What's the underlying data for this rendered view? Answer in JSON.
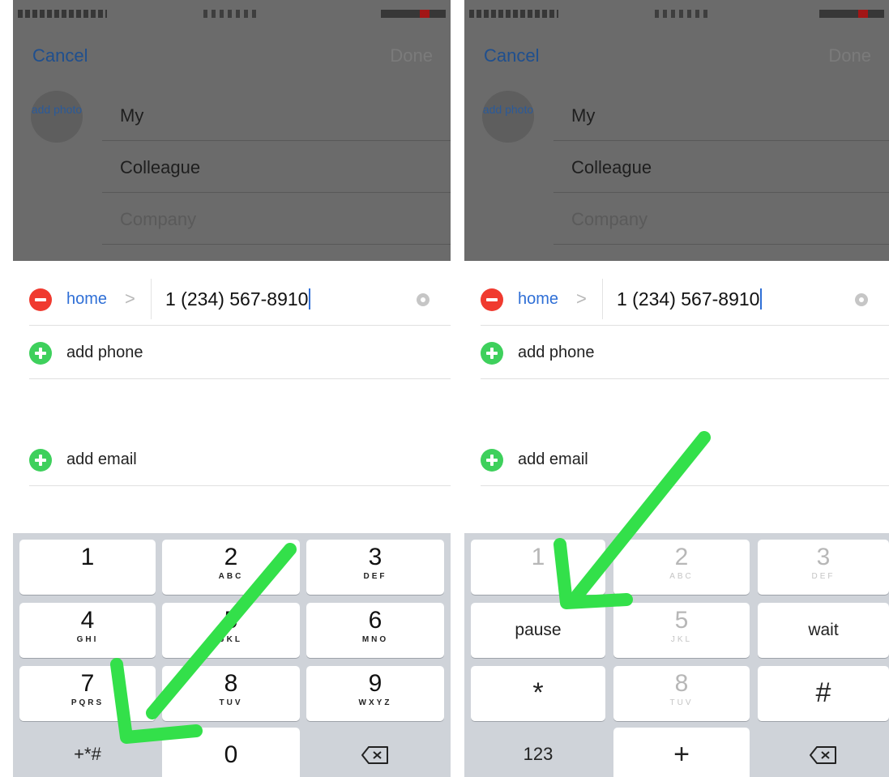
{
  "left": {
    "nav": {
      "cancel": "Cancel",
      "done": "Done"
    },
    "add_photo": "add photo",
    "first_name": "My",
    "last_name": "Colleague",
    "company_placeholder": "Company",
    "phone": {
      "label": "home",
      "chevron": ">",
      "value": "1 (234) 567-8910"
    },
    "add_phone": "add phone",
    "add_email": "add email",
    "keypad": {
      "keys": [
        {
          "digit": "1",
          "letters": ""
        },
        {
          "digit": "2",
          "letters": "ABC"
        },
        {
          "digit": "3",
          "letters": "DEF"
        },
        {
          "digit": "4",
          "letters": "GHI"
        },
        {
          "digit": "5",
          "letters": "JKL"
        },
        {
          "digit": "6",
          "letters": "MNO"
        },
        {
          "digit": "7",
          "letters": "PQRS"
        },
        {
          "digit": "8",
          "letters": "TUV"
        },
        {
          "digit": "9",
          "letters": "WXYZ"
        }
      ],
      "symbols_key": "+*#",
      "zero": "0"
    }
  },
  "right": {
    "nav": {
      "cancel": "Cancel",
      "done": "Done"
    },
    "add_photo": "add photo",
    "first_name": "My",
    "last_name": "Colleague",
    "company_placeholder": "Company",
    "phone": {
      "label": "home",
      "chevron": ">",
      "value": "1 (234) 567-8910"
    },
    "add_phone": "add phone",
    "add_email": "add email",
    "keypad": {
      "digit_1": "1",
      "digit_2": "2",
      "letters_2": "ABC",
      "digit_3": "3",
      "letters_3": "DEF",
      "pause": "pause",
      "digit_5": "5",
      "letters_5": "JKL",
      "wait": "wait",
      "star": "*",
      "digit_8": "8",
      "letters_8": "TUV",
      "hash": "#",
      "numbers_key": "123",
      "plus": "+"
    }
  },
  "colors": {
    "accent": "#2f6fd6",
    "delete": "#f03a2f",
    "add": "#3ed05c",
    "annotation": "#33e04a"
  }
}
